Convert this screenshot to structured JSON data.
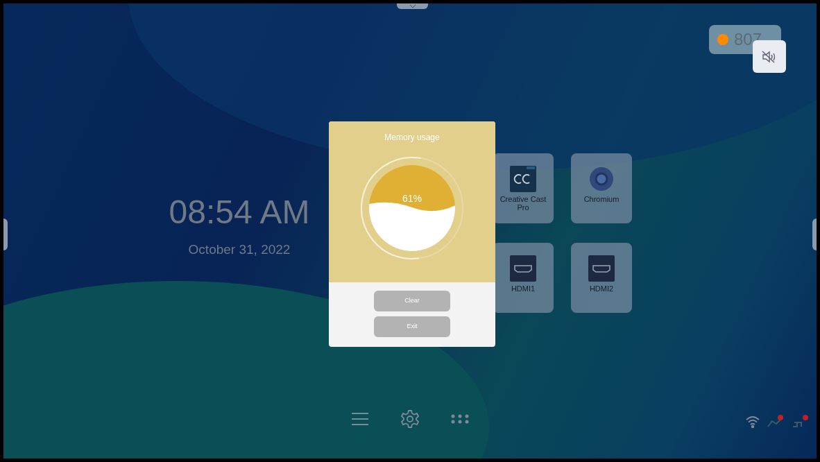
{
  "clock": {
    "time": "08:54 AM",
    "date": "October 31, 2022"
  },
  "apps": [
    {
      "label": "Creative Cast Pro",
      "kind": "cast"
    },
    {
      "label": "Chromium",
      "kind": "browser"
    },
    {
      "label": "HDMI1",
      "kind": "hdmi"
    },
    {
      "label": "HDMI2",
      "kind": "hdmi"
    }
  ],
  "status_pill": {
    "text": "807"
  },
  "dialog": {
    "title": "Memory usage",
    "reading": "61%",
    "level": 0.61,
    "buttons": [
      "Clear",
      "Exit"
    ]
  }
}
